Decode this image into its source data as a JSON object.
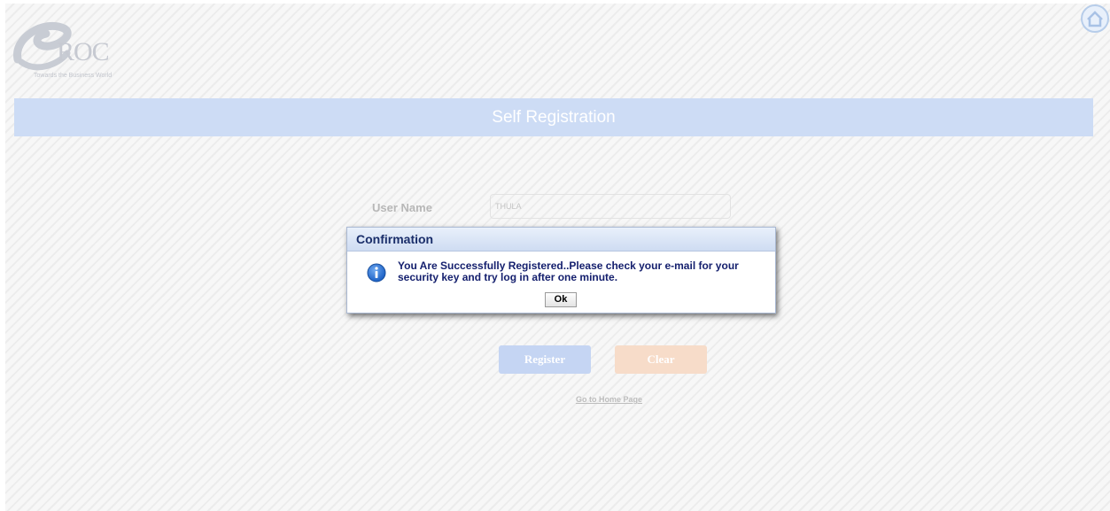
{
  "logo": {
    "text": "ROC",
    "tagline": "Towards the Business World"
  },
  "header": {
    "title": "Self Registration"
  },
  "form": {
    "username_label": "User Name",
    "username_value": "THULA"
  },
  "buttons": {
    "register_label": "Register",
    "clear_label": "Clear"
  },
  "links": {
    "home_label": "Go to Home Page"
  },
  "dialog": {
    "title": "Confirmation",
    "message": "You Are Successfully Registered..Please check your e-mail for your security key and try log in after one minute.",
    "ok_label": "Ok"
  },
  "icons": {
    "home": "home-icon",
    "info": "info-icon",
    "logo": "logo-swirl-icon"
  },
  "colors": {
    "title_bar": "#cddcf5",
    "register_button": "#c5d5f3",
    "clear_button": "#f7dcc9",
    "dialog_title": "#1a2e6a",
    "dialog_message": "#15206e"
  }
}
